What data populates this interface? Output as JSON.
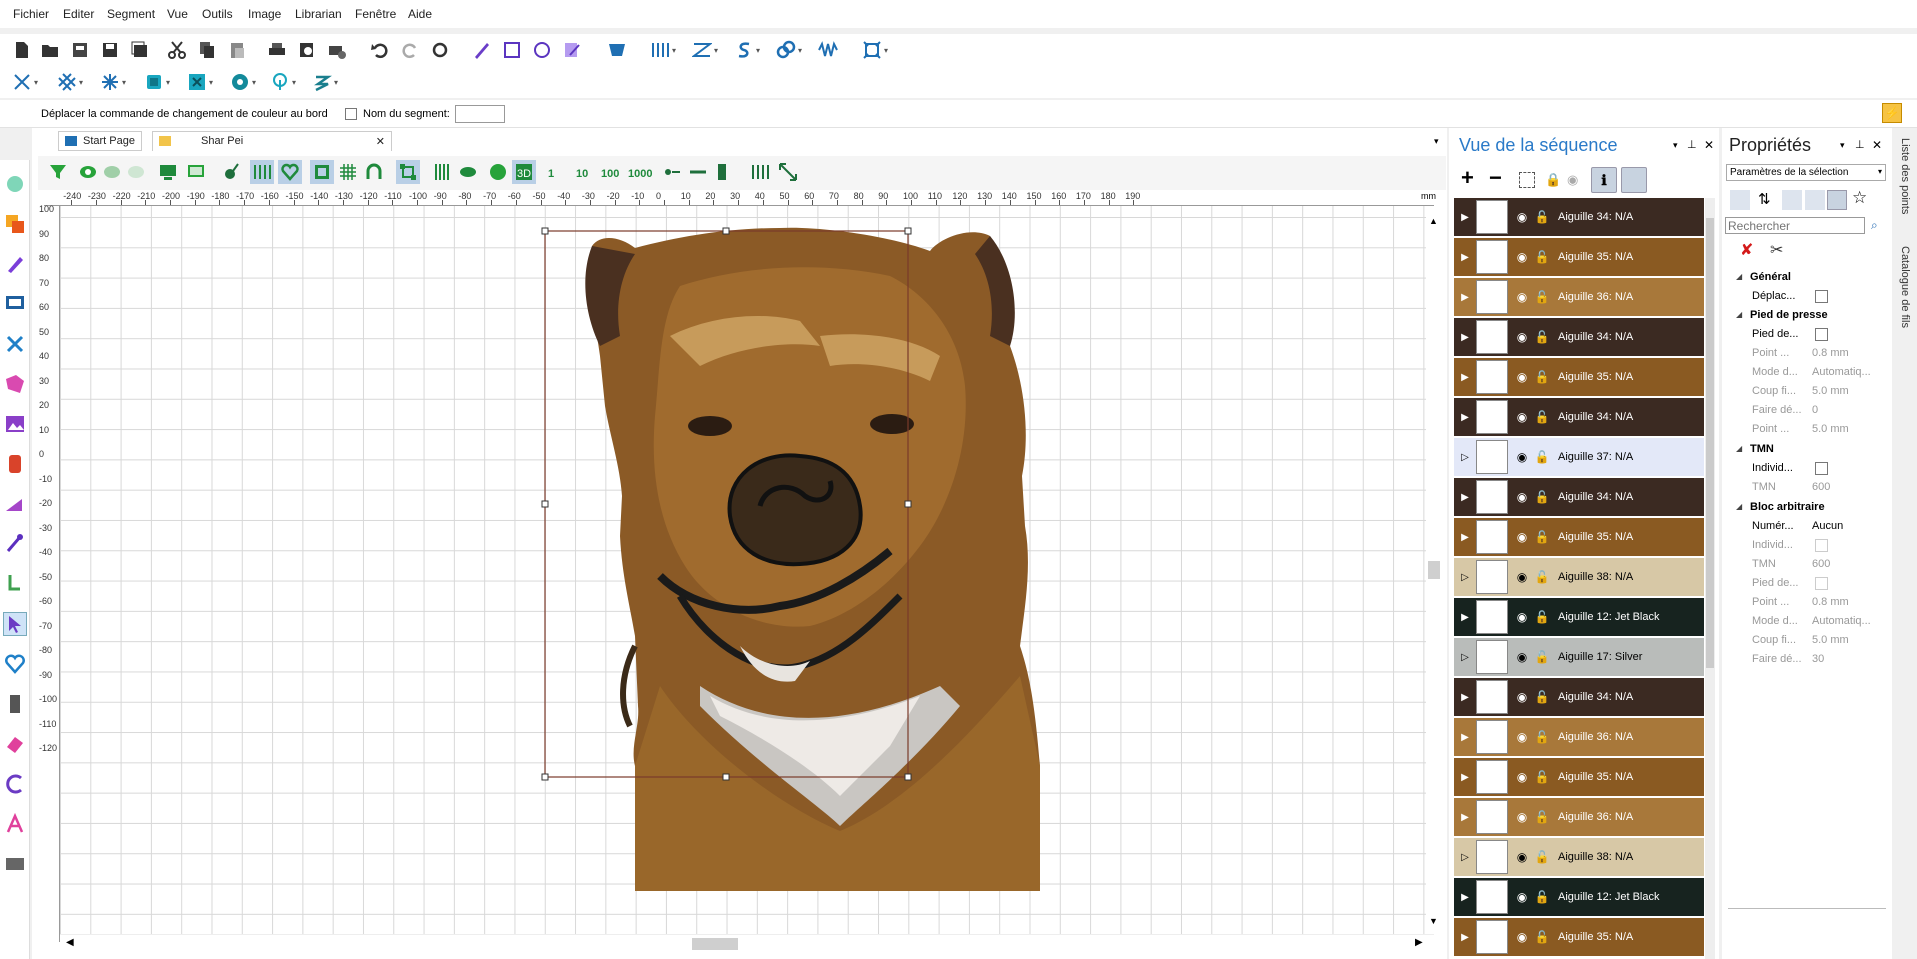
{
  "menu": [
    "Fichier",
    "Editer",
    "Segment",
    "Vue",
    "Outils",
    "Image",
    "Librarian",
    "Fenêtre",
    "Aide"
  ],
  "option_bar": {
    "move_color_change_label": "Déplacer la commande de changement de couleur au bord",
    "segment_name_label": "Nom du segment:",
    "segment_name_value": ""
  },
  "tabs": {
    "start_page": "Start Page",
    "document": "Shar Pei"
  },
  "view_toolbar": {
    "labels": [
      "1",
      "10",
      "100",
      "1000"
    ]
  },
  "ruler_top": {
    "ticks": [
      "-240",
      "-230",
      "-220",
      "-210",
      "-200",
      "-190",
      "-180",
      "-170",
      "-160",
      "-150",
      "-140",
      "-130",
      "-120",
      "-110",
      "-100",
      "-90",
      "-80",
      "-70",
      "-60",
      "-50",
      "-40",
      "-30",
      "-20",
      "-10",
      "0",
      "10",
      "20",
      "30",
      "40",
      "50",
      "60",
      "70",
      "80",
      "90",
      "100",
      "110",
      "120",
      "130",
      "140",
      "150",
      "160",
      "170",
      "180",
      "190"
    ],
    "unit": "mm"
  },
  "ruler_left": {
    "ticks": [
      "100",
      "90",
      "80",
      "70",
      "60",
      "50",
      "40",
      "30",
      "20",
      "10",
      "0",
      "-10",
      "-20",
      "-30",
      "-40",
      "-50",
      "-60",
      "-70",
      "-80",
      "-90",
      "-100",
      "-110",
      "-120"
    ]
  },
  "sequence_view": {
    "title": "Vue de la séquence",
    "rows": [
      {
        "label": "Aiguille 34: N/A",
        "color": "#3b2a22",
        "text": "#fff"
      },
      {
        "label": "Aiguille 35: N/A",
        "color": "#8a5a22",
        "text": "#fff"
      },
      {
        "label": "Aiguille 36: N/A",
        "color": "#a8783a",
        "text": "#fff"
      },
      {
        "label": "Aiguille 34: N/A",
        "color": "#3b2a22",
        "text": "#fff"
      },
      {
        "label": "Aiguille 35: N/A",
        "color": "#8a5a22",
        "text": "#fff"
      },
      {
        "label": "Aiguille 34: N/A",
        "color": "#3b2a22",
        "text": "#fff"
      },
      {
        "label": "Aiguille 37: N/A",
        "color": "#e3e8f8",
        "text": "#000"
      },
      {
        "label": "Aiguille 34: N/A",
        "color": "#3b2a22",
        "text": "#fff"
      },
      {
        "label": "Aiguille 35: N/A",
        "color": "#8a5a22",
        "text": "#fff"
      },
      {
        "label": "Aiguille 38: N/A",
        "color": "#d7c8a6",
        "text": "#000"
      },
      {
        "label": "Aiguille 12: Jet Black",
        "color": "#17231f",
        "text": "#fff"
      },
      {
        "label": "Aiguille 17: Silver",
        "color": "#b9bcba",
        "text": "#000"
      },
      {
        "label": "Aiguille 34: N/A",
        "color": "#3b2a22",
        "text": "#fff"
      },
      {
        "label": "Aiguille 36: N/A",
        "color": "#a8783a",
        "text": "#fff"
      },
      {
        "label": "Aiguille 35: N/A",
        "color": "#8a5a22",
        "text": "#fff"
      },
      {
        "label": "Aiguille 36: N/A",
        "color": "#a8783a",
        "text": "#fff"
      },
      {
        "label": "Aiguille 38: N/A",
        "color": "#d7c8a6",
        "text": "#000"
      },
      {
        "label": "Aiguille 12: Jet Black",
        "color": "#17231f",
        "text": "#fff"
      },
      {
        "label": "Aiguille 35: N/A",
        "color": "#8a5a22",
        "text": "#fff"
      }
    ]
  },
  "properties": {
    "title": "Propriétés",
    "dropdown": "Paramètres de la sélection",
    "search_placeholder": "Rechercher",
    "sections": {
      "general": "Général",
      "presser": "Pied de presse",
      "tmn": "TMN",
      "bloc": "Bloc arbitraire"
    },
    "items": {
      "deplac": "Déplac...",
      "pied_de": "Pied de...",
      "point1": "Point ...",
      "point1_v": "0.8 mm",
      "mode1": "Mode d...",
      "mode1_v": "Automatiq...",
      "coup1": "Coup fi...",
      "coup1_v": "5.0 mm",
      "faire1": "Faire dé...",
      "faire1_v": "0",
      "point2": "Point ...",
      "point2_v": "5.0 mm",
      "individ1": "Individ...",
      "tmn1": "TMN",
      "tmn1_v": "600",
      "numer": "Numér...",
      "numer_v": "Aucun",
      "individ2": "Individ...",
      "tmn2": "TMN",
      "tmn2_v": "600",
      "pied2": "Pied de...",
      "point3": "Point ...",
      "point3_v": "0.8 mm",
      "mode2": "Mode d...",
      "mode2_v": "Automatiq...",
      "coup2": "Coup fi...",
      "coup2_v": "5.0 mm",
      "faire2": "Faire dé...",
      "faire2_v": "30"
    }
  },
  "right_strip": {
    "points_list": "Liste des points",
    "thread_catalog": "Catalogue de fils"
  }
}
